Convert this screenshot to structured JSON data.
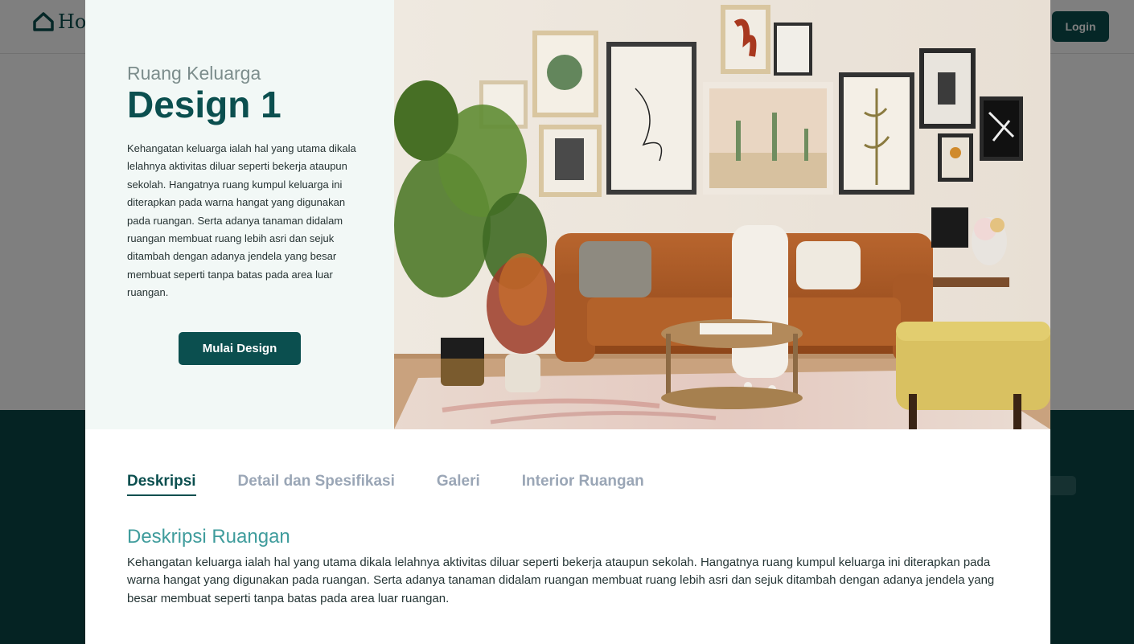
{
  "background": {
    "logo_text": "Ho",
    "login_label": "Login"
  },
  "hero": {
    "subtitle": "Ruang Keluarga",
    "title": "Design 1",
    "description": "Kehangatan keluarga ialah hal yang utama dikala lelahnya aktivitas diluar seperti bekerja ataupun sekolah. Hangatnya ruang kumpul keluarga ini diterapkan pada warna hangat yang digunakan pada ruangan. Serta adanya tanaman didalam ruangan membuat ruang lebih asri dan sejuk ditambah dengan adanya jendela yang besar membuat seperti tanpa batas pada area luar ruangan.",
    "cta_label": "Mulai Design"
  },
  "tabs": [
    {
      "label": "Deskripsi",
      "active": true
    },
    {
      "label": "Detail dan Spesifikasi",
      "active": false
    },
    {
      "label": "Galeri",
      "active": false
    },
    {
      "label": "Interior Ruangan",
      "active": false
    }
  ],
  "section": {
    "title": "Deskripsi Ruangan",
    "body": "Kehangatan keluarga ialah hal yang utama dikala lelahnya aktivitas diluar seperti bekerja ataupun sekolah. Hangatnya ruang kumpul keluarga ini diterapkan pada warna hangat yang digunakan pada ruangan. Serta adanya tanaman didalam ruangan membuat ruang lebih asri dan sejuk ditambah dengan adanya jendela yang besar membuat seperti tanpa batas pada area luar ruangan."
  },
  "colors": {
    "primary": "#0b4f4f",
    "accent_title": "#3f9c9c",
    "tab_inactive": "#9aa6b6",
    "hero_panel": "#f2f8f6"
  }
}
